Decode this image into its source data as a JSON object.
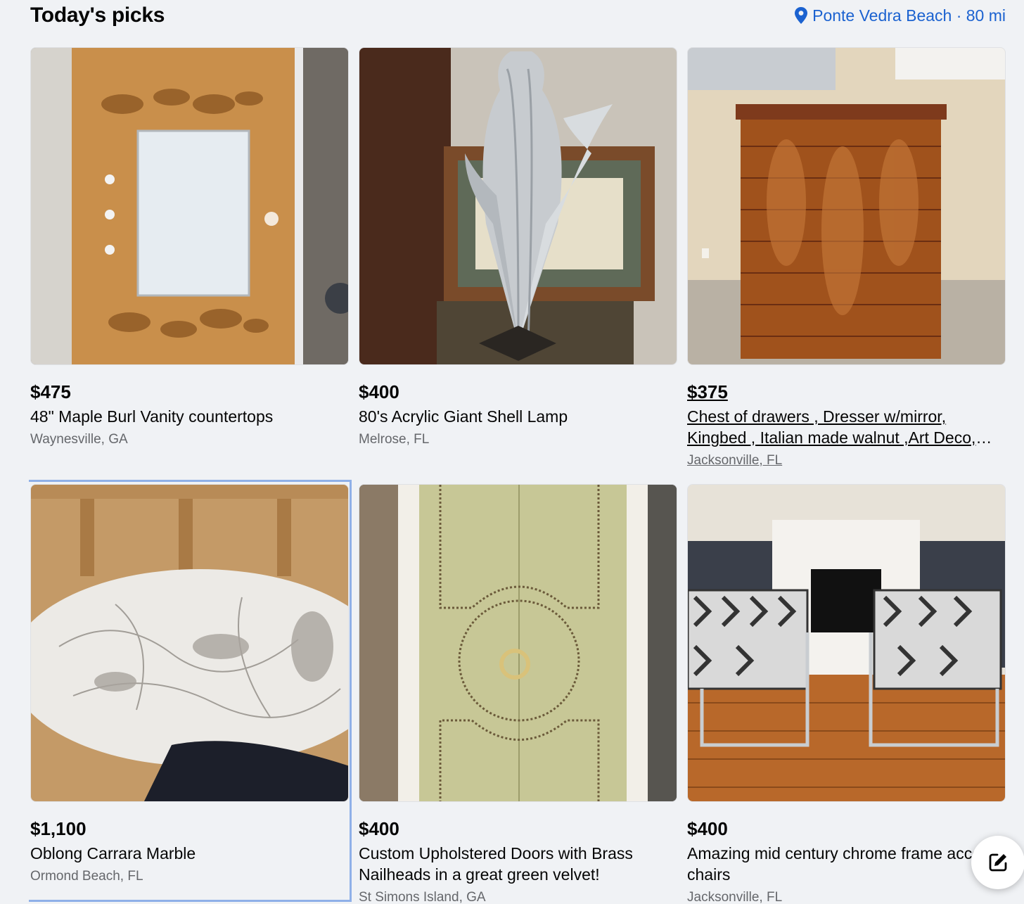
{
  "header": {
    "title": "Today's picks",
    "location": "Ponte Vedra Beach · 80 mi"
  },
  "colors": {
    "accent": "#1b62d0",
    "background": "#f0f2f5",
    "secondary_text": "#65676b"
  },
  "listings": [
    {
      "price": "$475",
      "title": "48\" Maple Burl Vanity countertops",
      "location": "Waynesville, GA"
    },
    {
      "price": "$400",
      "title": "80's Acrylic Giant Shell Lamp",
      "location": "Melrose, FL"
    },
    {
      "price": "$375",
      "title": "Chest of drawers , Dresser w/mirror, Kingbed , Italian made walnut ,Art Deco, Mid Century",
      "location": "Jacksonville, FL"
    },
    {
      "price": "$1,100",
      "title": "Oblong Carrara Marble",
      "location": "Ormond Beach, FL"
    },
    {
      "price": "$400",
      "title": "Custom Upholstered Doors with Brass Nailheads in a great green velvet!",
      "location": "St Simons Island, GA"
    },
    {
      "price": "$400",
      "title": "Amazing mid century chrome frame accent chairs",
      "location": "Jacksonville, FL"
    }
  ],
  "fab": {
    "icon": "compose-icon"
  }
}
